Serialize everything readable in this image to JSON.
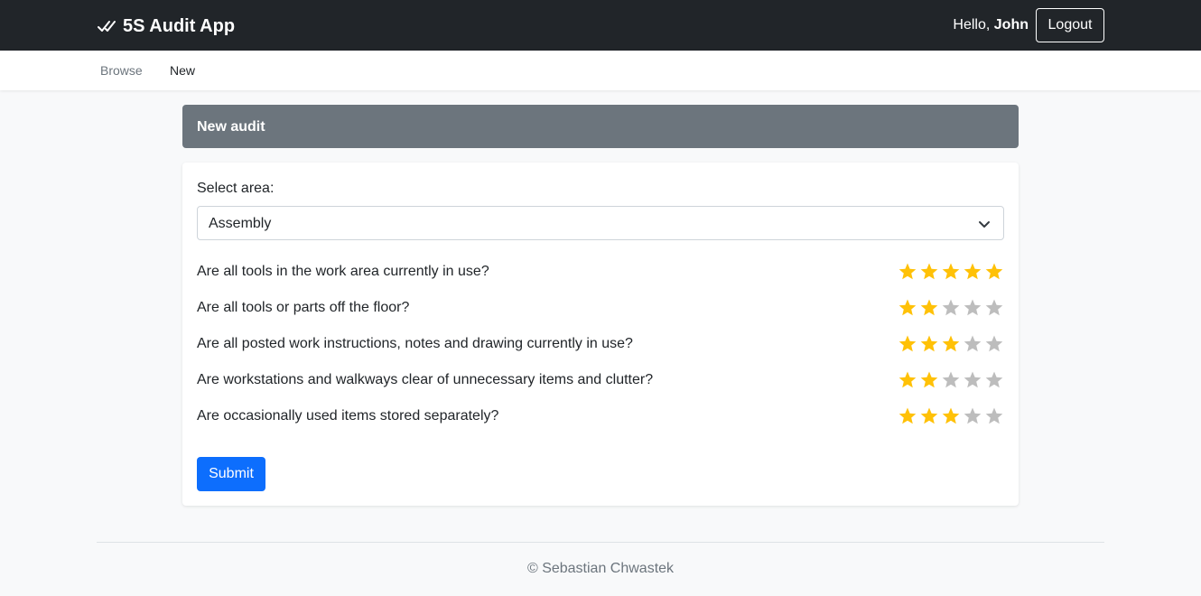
{
  "app": {
    "title": "5S Audit App",
    "logo_icon": "double-check-icon"
  },
  "user": {
    "greeting": "Hello,",
    "name": "John",
    "logout_label": "Logout"
  },
  "nav": [
    {
      "label": "Browse",
      "active": false
    },
    {
      "label": "New",
      "active": true
    }
  ],
  "page": {
    "header": "New audit"
  },
  "form": {
    "area_label": "Select area:",
    "area_value": "Assembly",
    "max_rating": 5,
    "questions": [
      {
        "text": "Are all tools in the work area currently in use?",
        "rating": 5
      },
      {
        "text": "Are all tools or parts off the floor?",
        "rating": 2
      },
      {
        "text": "Are all posted work instructions, notes and drawing currently in use?",
        "rating": 3
      },
      {
        "text": "Are workstations and walkways clear of unnecessary items and clutter?",
        "rating": 2
      },
      {
        "text": "Are occasionally used items stored separately?",
        "rating": 3
      }
    ],
    "submit_label": "Submit"
  },
  "footer": {
    "text": "© Sebastian Chwastek"
  },
  "colors": {
    "navbar": "#212529",
    "header_bar": "#6c757d",
    "primary": "#0d6efd",
    "star_filled": "#ffc107",
    "star_empty": "#bdbdbd"
  }
}
